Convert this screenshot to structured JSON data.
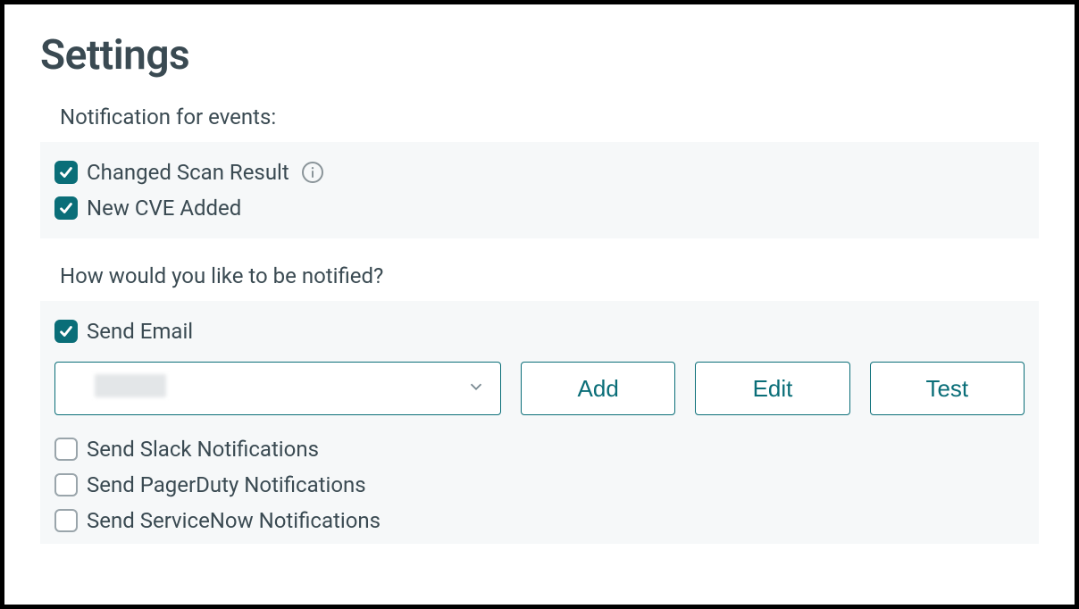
{
  "page_title": "Settings",
  "events_section": {
    "label": "Notification for events:",
    "options": [
      {
        "label": "Changed Scan Result",
        "checked": true,
        "has_info": true
      },
      {
        "label": "New CVE Added",
        "checked": true,
        "has_info": false
      }
    ]
  },
  "notify_section": {
    "label": "How would you like to be notified?",
    "email_option": {
      "label": "Send Email",
      "checked": true
    },
    "dropdown_value": "",
    "buttons": {
      "add": "Add",
      "edit": "Edit",
      "test": "Test"
    },
    "channels": [
      {
        "label": "Send Slack Notifications",
        "checked": false
      },
      {
        "label": "Send PagerDuty Notifications",
        "checked": false
      },
      {
        "label": "Send ServiceNow Notifications",
        "checked": false
      }
    ]
  }
}
